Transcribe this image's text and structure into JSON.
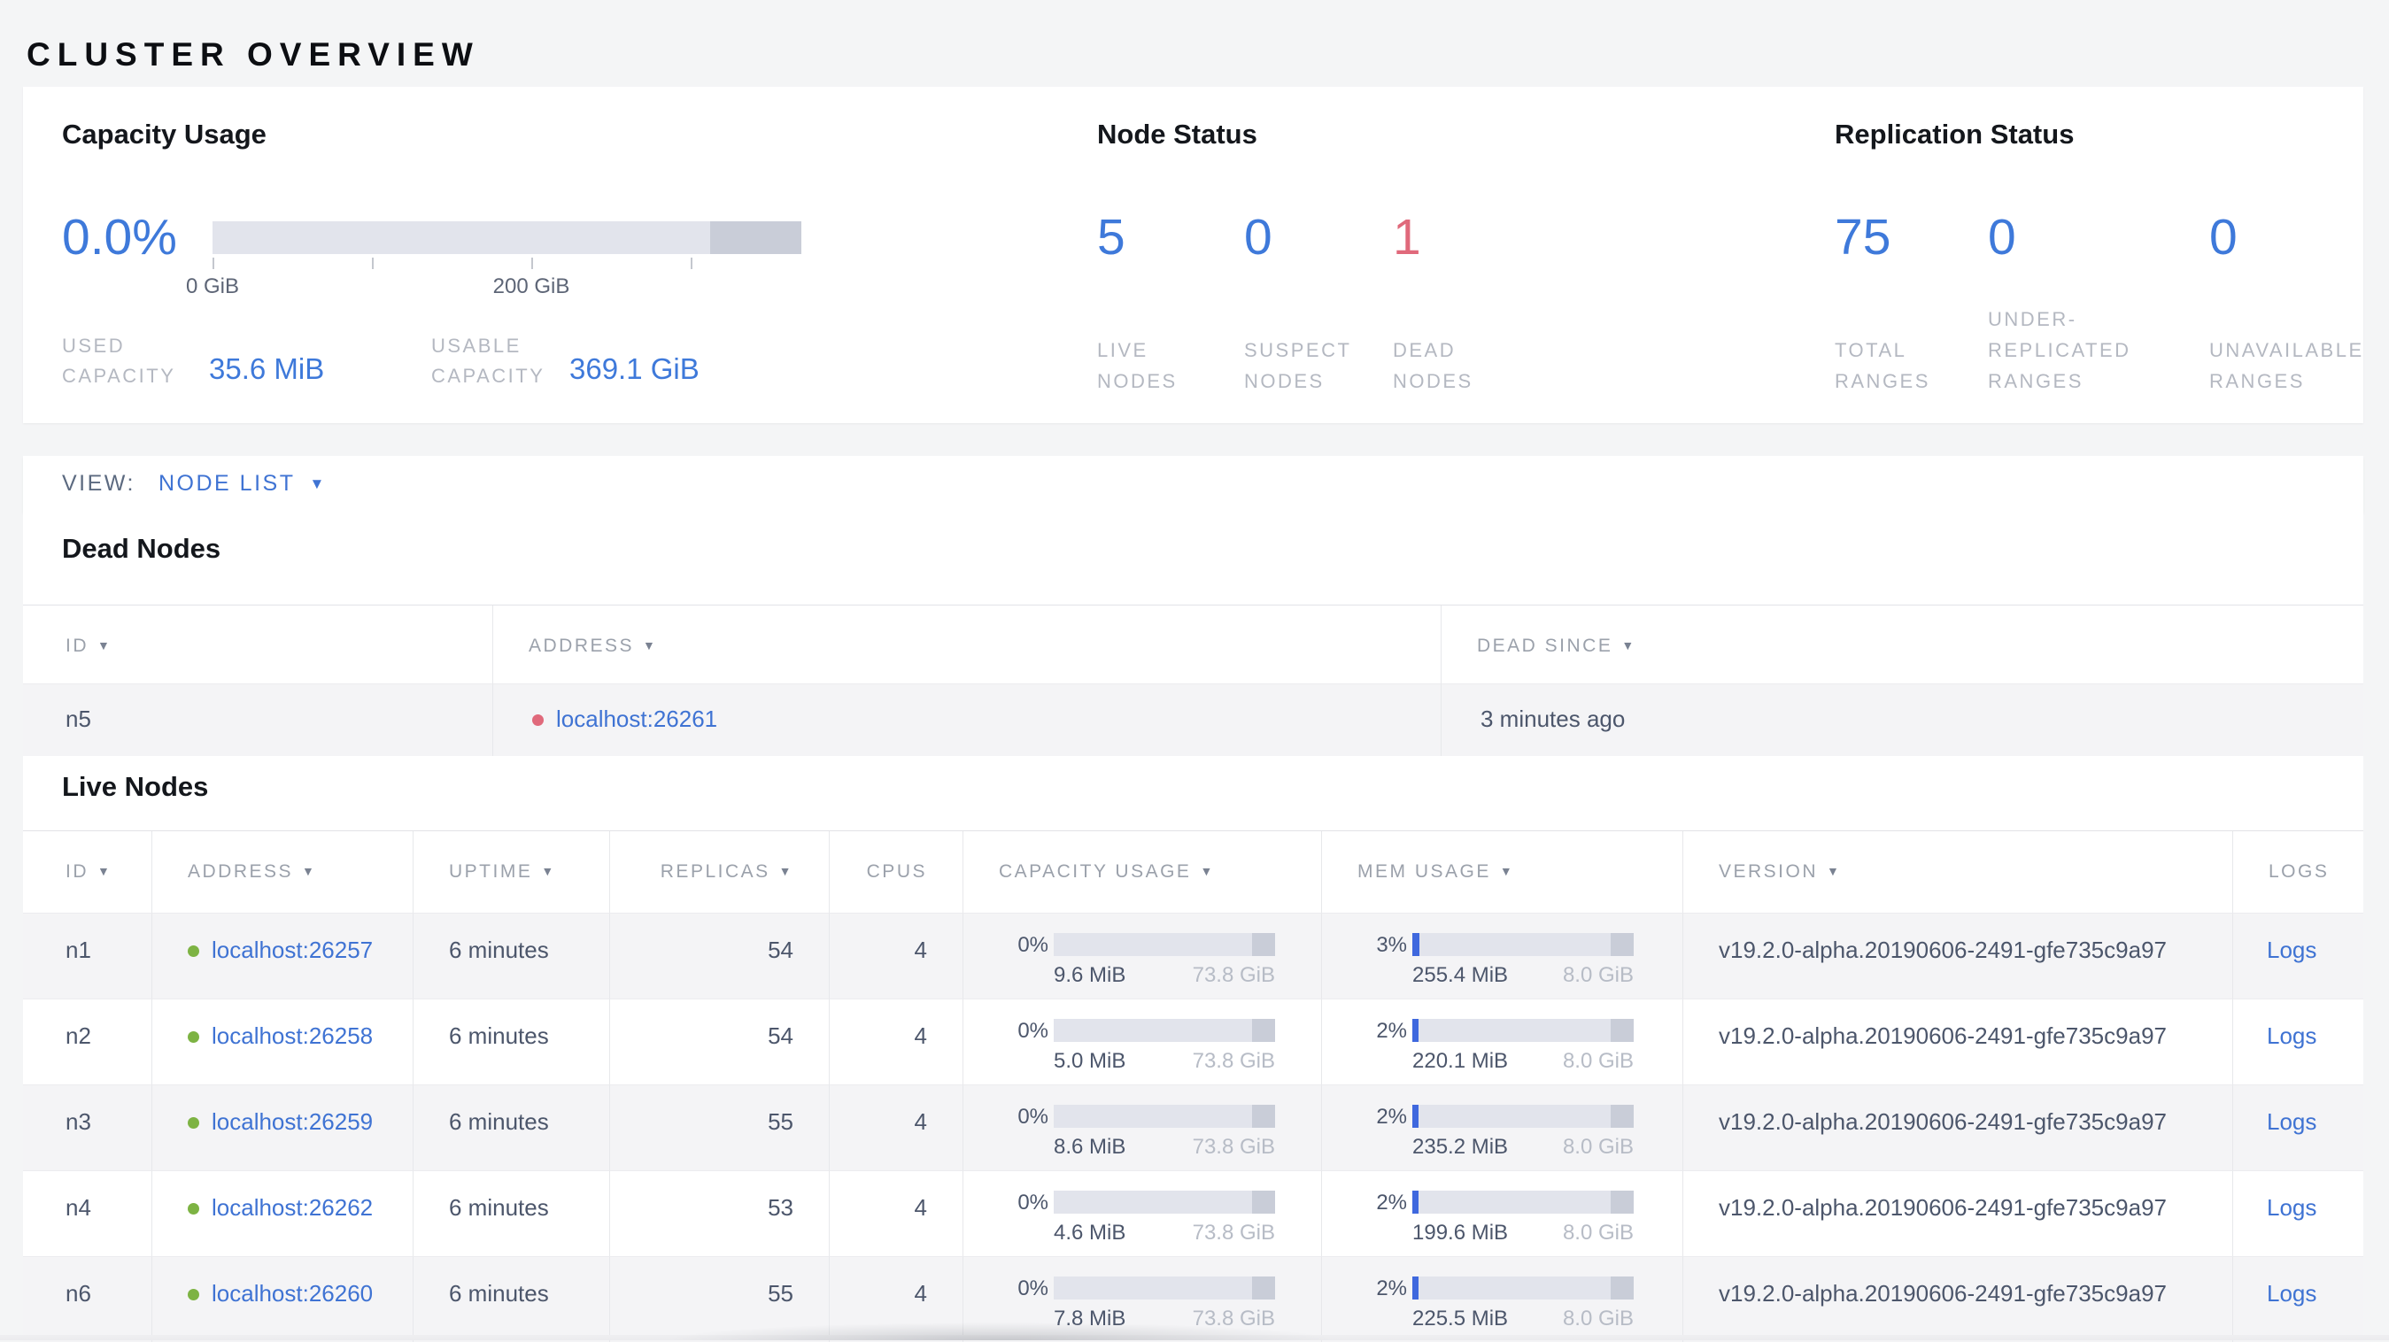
{
  "page_title": "CLUSTER OVERVIEW",
  "colors": {
    "accent_blue": "#3e79da",
    "accent_red": "#e0697b",
    "link_blue": "#3f73d3",
    "live_green": "#7db343"
  },
  "capacity": {
    "title": "Capacity Usage",
    "percent": "0.0%",
    "tick_labels": [
      "0 GiB",
      "200 GiB"
    ],
    "used_label": "USED\nCAPACITY",
    "used_value": "35.6 MiB",
    "usable_label": "USABLE\nCAPACITY",
    "usable_value": "369.1 GiB"
  },
  "node_status": {
    "title": "Node Status",
    "stats": [
      {
        "value": "5",
        "label": "LIVE\nNODES",
        "accent": "blue"
      },
      {
        "value": "0",
        "label": "SUSPECT\nNODES",
        "accent": "blue"
      },
      {
        "value": "1",
        "label": "DEAD\nNODES",
        "accent": "red"
      }
    ]
  },
  "replication": {
    "title": "Replication Status",
    "stats": [
      {
        "value": "75",
        "label": "TOTAL\nRANGES",
        "accent": "blue"
      },
      {
        "value": "0",
        "label": "UNDER-\nREPLICATED\nRANGES",
        "accent": "blue"
      },
      {
        "value": "0",
        "label": "UNAVAILABLE\nRANGES",
        "accent": "blue"
      }
    ]
  },
  "view_bar": {
    "label": "VIEW:",
    "selected": "NODE LIST"
  },
  "dead_nodes": {
    "title": "Dead Nodes",
    "columns": [
      {
        "label": "ID",
        "sorted": true
      },
      {
        "label": "ADDRESS",
        "sorted": true
      },
      {
        "label": "DEAD SINCE",
        "sorted": true
      }
    ],
    "rows": [
      {
        "id": "n5",
        "address": "localhost:26261",
        "dead_since": "3 minutes ago"
      }
    ]
  },
  "live_nodes": {
    "title": "Live Nodes",
    "columns": [
      {
        "label": "ID",
        "sorted": true
      },
      {
        "label": "ADDRESS",
        "sorted": true
      },
      {
        "label": "UPTIME",
        "sorted": true
      },
      {
        "label": "REPLICAS",
        "sorted": true
      },
      {
        "label": "CPUS",
        "sorted": false
      },
      {
        "label": "CAPACITY USAGE",
        "sorted": true
      },
      {
        "label": "MEM USAGE",
        "sorted": true
      },
      {
        "label": "VERSION",
        "sorted": true
      },
      {
        "label": "LOGS",
        "sorted": false
      }
    ],
    "rows": [
      {
        "id": "n1",
        "address": "localhost:26257",
        "uptime": "6 minutes",
        "replicas": "54",
        "cpus": "4",
        "capacity": {
          "percent": "0%",
          "used": "9.6 MiB",
          "total": "73.8 GiB",
          "frac": 0
        },
        "memory": {
          "percent": "3%",
          "used": "255.4 MiB",
          "total": "8.0 GiB",
          "frac": 0.03
        },
        "version": "v19.2.0-alpha.20190606-2491-gfe735c9a97",
        "logs": "Logs"
      },
      {
        "id": "n2",
        "address": "localhost:26258",
        "uptime": "6 minutes",
        "replicas": "54",
        "cpus": "4",
        "capacity": {
          "percent": "0%",
          "used": "5.0 MiB",
          "total": "73.8 GiB",
          "frac": 0
        },
        "memory": {
          "percent": "2%",
          "used": "220.1 MiB",
          "total": "8.0 GiB",
          "frac": 0.02
        },
        "version": "v19.2.0-alpha.20190606-2491-gfe735c9a97",
        "logs": "Logs"
      },
      {
        "id": "n3",
        "address": "localhost:26259",
        "uptime": "6 minutes",
        "replicas": "55",
        "cpus": "4",
        "capacity": {
          "percent": "0%",
          "used": "8.6 MiB",
          "total": "73.8 GiB",
          "frac": 0
        },
        "memory": {
          "percent": "2%",
          "used": "235.2 MiB",
          "total": "8.0 GiB",
          "frac": 0.02
        },
        "version": "v19.2.0-alpha.20190606-2491-gfe735c9a97",
        "logs": "Logs"
      },
      {
        "id": "n4",
        "address": "localhost:26262",
        "uptime": "6 minutes",
        "replicas": "53",
        "cpus": "4",
        "capacity": {
          "percent": "0%",
          "used": "4.6 MiB",
          "total": "73.8 GiB",
          "frac": 0
        },
        "memory": {
          "percent": "2%",
          "used": "199.6 MiB",
          "total": "8.0 GiB",
          "frac": 0.02
        },
        "version": "v19.2.0-alpha.20190606-2491-gfe735c9a97",
        "logs": "Logs"
      },
      {
        "id": "n6",
        "address": "localhost:26260",
        "uptime": "6 minutes",
        "replicas": "55",
        "cpus": "4",
        "capacity": {
          "percent": "0%",
          "used": "7.8 MiB",
          "total": "73.8 GiB",
          "frac": 0
        },
        "memory": {
          "percent": "2%",
          "used": "225.5 MiB",
          "total": "8.0 GiB",
          "frac": 0.02
        },
        "version": "v19.2.0-alpha.20190606-2491-gfe735c9a97",
        "logs": "Logs"
      }
    ]
  }
}
